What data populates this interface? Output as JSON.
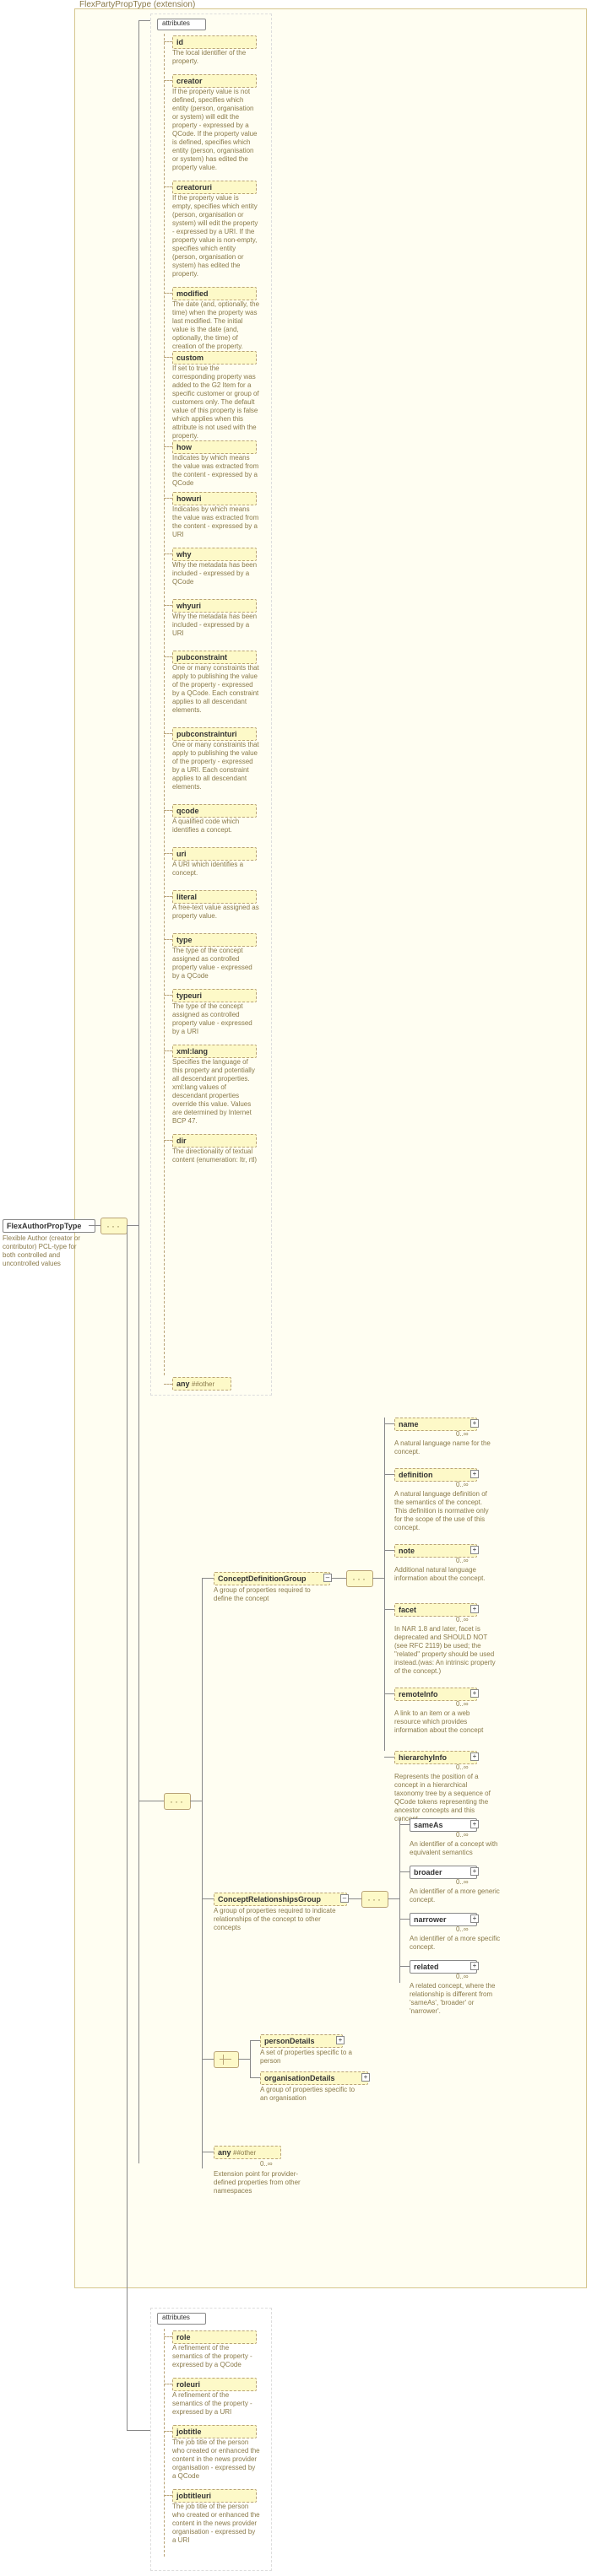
{
  "root": {
    "title": "FlexAuthorPropType",
    "desc": "Flexible Author (creator or contributor) PCL-type for both controlled and uncontrolled values"
  },
  "ext_label": "FlexPartyPropType (extension)",
  "attr_heading": "attributes",
  "attrs": [
    {
      "name": "id",
      "desc": "The local identifier of the property."
    },
    {
      "name": "creator",
      "desc": "If the property value is not defined, specifies which entity (person, organisation or system) will edit the property - expressed by a QCode. If the property value is defined, specifies which entity (person, organisation or system) has edited the property value."
    },
    {
      "name": "creatoruri",
      "desc": "If the property value is empty, specifies which entity (person, organisation or system) will edit the property - expressed by a URI. If the property value is non-empty, specifies which entity (person, organisation or system) has edited the property."
    },
    {
      "name": "modified",
      "desc": "The date (and, optionally, the time) when the property was last modified. The initial value is the date (and, optionally, the time) of creation of the property."
    },
    {
      "name": "custom",
      "desc": "If set to true the corresponding property was added to the G2 Item for a specific customer or group of customers only. The default value of this property is false which applies when this attribute is not used with the property."
    },
    {
      "name": "how",
      "desc": "Indicates by which means the value was extracted from the content - expressed by a QCode"
    },
    {
      "name": "howuri",
      "desc": "Indicates by which means the value was extracted from the content - expressed by a URI"
    },
    {
      "name": "why",
      "desc": "Why the metadata has been included - expressed by a QCode"
    },
    {
      "name": "whyuri",
      "desc": "Why the metadata has been included - expressed by a URI"
    },
    {
      "name": "pubconstraint",
      "desc": "One or many constraints that apply to publishing the value of the property - expressed by a QCode. Each constraint applies to all descendant elements."
    },
    {
      "name": "pubconstrainturi",
      "desc": "One or many constraints that apply to publishing the value of the property - expressed by a URI. Each constraint applies to all descendant elements."
    },
    {
      "name": "qcode",
      "desc": "A qualified code which identifies a concept."
    },
    {
      "name": "uri",
      "desc": "A URI which identifies a concept."
    },
    {
      "name": "literal",
      "desc": "A free-text value assigned as property value."
    },
    {
      "name": "type",
      "desc": "The type of the concept assigned as controlled property value - expressed by a QCode"
    },
    {
      "name": "typeuri",
      "desc": "The type of the concept assigned as controlled property value - expressed by a URI"
    },
    {
      "name": "xml:lang",
      "desc": "Specifies the language of this property and potentially all descendant properties. xml:lang values of descendant properties override this value. Values are determined by Internet BCP 47."
    },
    {
      "name": "dir",
      "desc": "The directionality of textual content (enumeration: ltr, rtl)"
    }
  ],
  "any_other": "##other",
  "groups": {
    "cdg": {
      "name": "ConceptDefinitionGroup",
      "desc": "A group of properties required to define the concept"
    },
    "crg": {
      "name": "ConceptRelationshipsGroup",
      "desc": "A group of properties required to indicate relationships of the concept to other concepts"
    },
    "pd": {
      "name": "personDetails",
      "desc": "A set of properties specific to a person"
    },
    "od": {
      "name": "organisationDetails",
      "desc": "A group of properties specific to an organisation"
    },
    "any": {
      "label": "##other",
      "desc": "Extension point for provider-defined properties from other namespaces"
    }
  },
  "def_children": [
    {
      "name": "name",
      "desc": "A natural language name for the concept."
    },
    {
      "name": "definition",
      "desc": "A natural language definition of the semantics of the concept. This definition is normative only for the scope of the use of this concept."
    },
    {
      "name": "note",
      "desc": "Additional natural language information about the concept."
    },
    {
      "name": "facet",
      "desc": "In NAR 1.8 and later, facet is deprecated and SHOULD NOT (see RFC 2119) be used; the \"related\" property should be used instead.(was: An intrinsic property of the concept.)"
    },
    {
      "name": "remoteInfo",
      "desc": "A link to an item or a web resource which provides information about the concept"
    },
    {
      "name": "hierarchyInfo",
      "desc": "Represents the position of a concept in a hierarchical taxonomy tree by a sequence of QCode tokens representing the ancestor concepts and this concept"
    }
  ],
  "rel_children": [
    {
      "name": "sameAs",
      "desc": "An identifier of a concept with equivalent semantics"
    },
    {
      "name": "broader",
      "desc": "An identifier of a more generic concept."
    },
    {
      "name": "narrower",
      "desc": "An identifier of a more specific concept."
    },
    {
      "name": "related",
      "desc": "A related concept, where the relationship is different from 'sameAs', 'broader' or 'narrower'."
    }
  ],
  "card": {
    "zero_inf": "0..∞"
  },
  "ext_attrs_heading": "attributes",
  "ext_attrs": [
    {
      "name": "role",
      "desc": "A refinement of the semantics of the property - expressed by a QCode"
    },
    {
      "name": "roleuri",
      "desc": "A refinement of the semantics of the property - expressed by a URI"
    },
    {
      "name": "jobtitle",
      "desc": "The job title of the person who created or enhanced the content in the news provider organisation - expressed by a QCode"
    },
    {
      "name": "jobtitleuri",
      "desc": "The job title of the person who created or enhanced the content in the news provider organisation - expressed by a URI"
    }
  ],
  "any_label": "any"
}
